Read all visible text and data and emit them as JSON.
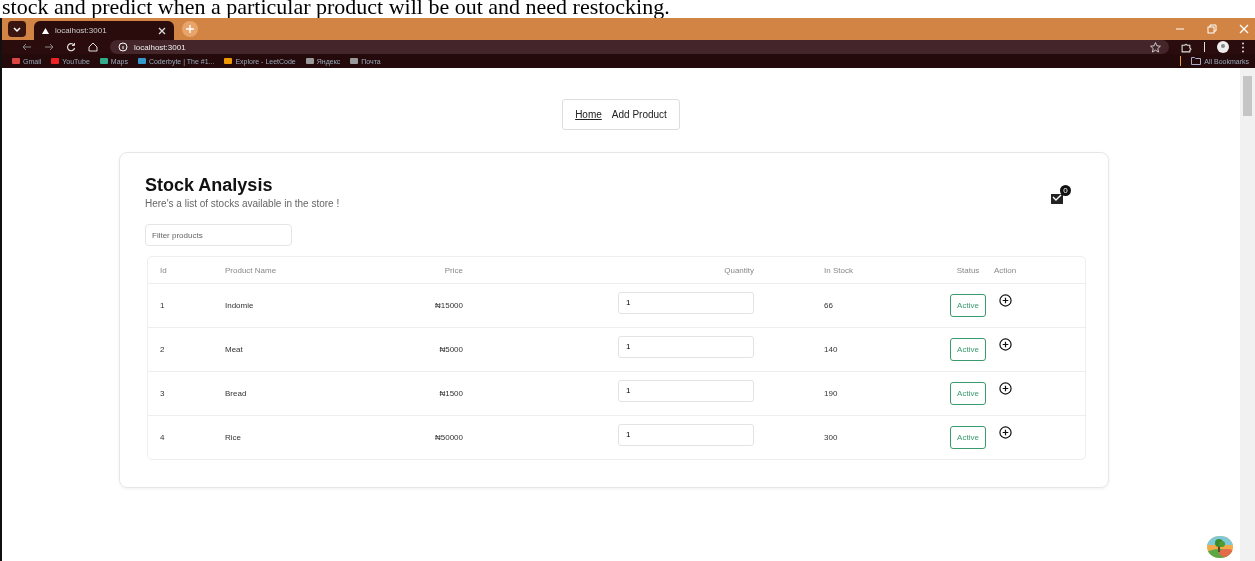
{
  "caption": "stock and predict when a particular product will be out and need restocking.",
  "browser": {
    "tab": {
      "title": "localhost:3001"
    },
    "url": "localhost:3001",
    "bookmarks": [
      "Gmail",
      "YouTube",
      "Maps",
      "Coderbyte | The #1...",
      "Explore - LeetCode",
      "Яндекс",
      "Почта"
    ],
    "all_bookmarks": "All Bookmarks"
  },
  "nav": [
    {
      "label": "Home",
      "selected": true
    },
    {
      "label": "Add Product",
      "selected": false
    }
  ],
  "header": {
    "title": "Stock Analysis",
    "subtitle": "Here's a list of stocks available in the store !",
    "cart_count": "0"
  },
  "filter": {
    "placeholder": "Filter products"
  },
  "table": {
    "columns": [
      "Id",
      "Product Name",
      "Price",
      "Quantity",
      "In Stock",
      "Status",
      "Action"
    ],
    "rows": [
      {
        "id": "1",
        "name": "Indomie",
        "price": "₦15000",
        "quantity": "1",
        "in_stock": "66",
        "status": "Active"
      },
      {
        "id": "2",
        "name": "Meat",
        "price": "₦5000",
        "quantity": "1",
        "in_stock": "140",
        "status": "Active"
      },
      {
        "id": "3",
        "name": "Bread",
        "price": "₦1500",
        "quantity": "1",
        "in_stock": "190",
        "status": "Active"
      },
      {
        "id": "4",
        "name": "Rice",
        "price": "₦50000",
        "quantity": "1",
        "in_stock": "300",
        "status": "Active"
      }
    ]
  }
}
